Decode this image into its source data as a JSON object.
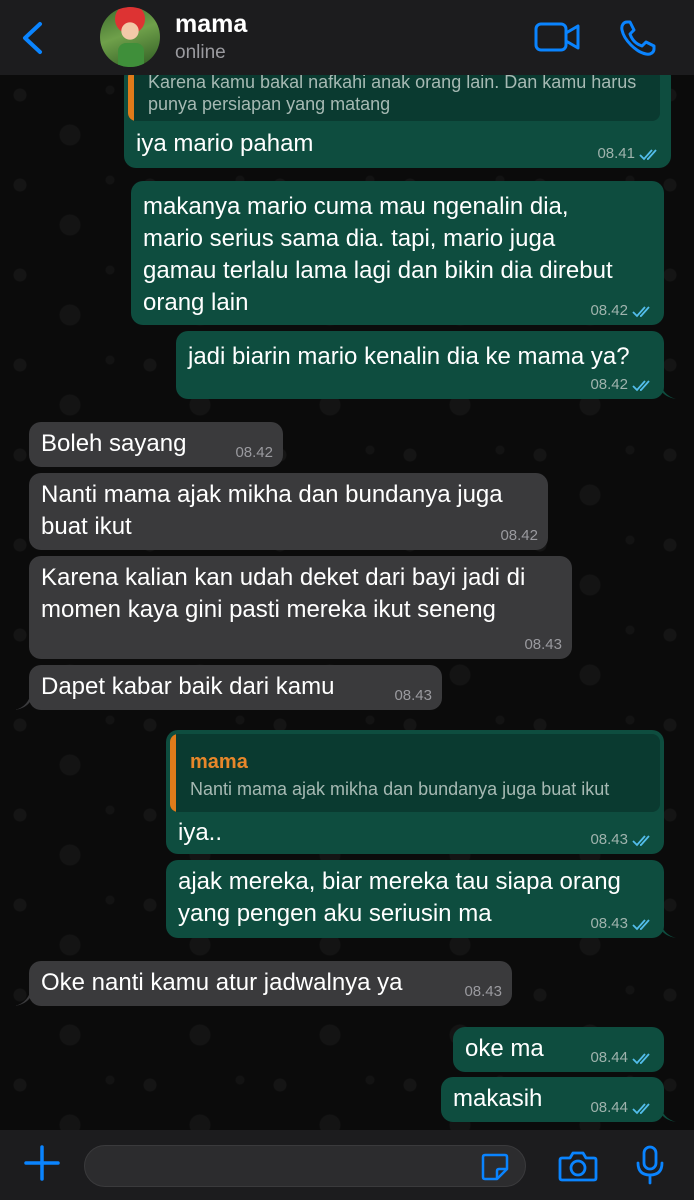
{
  "header": {
    "contact_name": "mama",
    "status": "online"
  },
  "messages": [
    {
      "id": "m1",
      "direction": "out",
      "quote_text": "Karena kamu bakal nafkahi anak orang lain. Dan kamu harus punya persiapan yang matang",
      "text": "iya mario paham",
      "time": "08.41"
    },
    {
      "id": "m2",
      "direction": "out",
      "text": "makanya mario cuma mau ngenalin dia,\nmario serius sama dia. tapi, mario juga\ngamau terlalu lama lagi dan bikin dia direbut\norang lain",
      "time": "08.42"
    },
    {
      "id": "m3",
      "direction": "out",
      "text": "jadi biarin mario kenalin dia ke mama ya?",
      "time": "08.42"
    },
    {
      "id": "m4",
      "direction": "in",
      "text": "Boleh sayang",
      "time": "08.42"
    },
    {
      "id": "m5",
      "direction": "in",
      "text": "Nanti mama ajak mikha dan bundanya juga\nbuat ikut",
      "time": "08.42"
    },
    {
      "id": "m6",
      "direction": "in",
      "text": "Karena kalian kan udah deket dari bayi jadi di\nmomen kaya gini pasti mereka ikut seneng",
      "time": "08.43"
    },
    {
      "id": "m7",
      "direction": "in",
      "text": "Dapet kabar baik dari kamu",
      "time": "08.43"
    },
    {
      "id": "m8",
      "direction": "out",
      "quote_author": "mama",
      "quote_text": "Nanti mama ajak mikha dan bundanya juga buat ikut",
      "text": "iya..",
      "time": "08.43"
    },
    {
      "id": "m9",
      "direction": "out",
      "text": "ajak mereka, biar mereka tau siapa orang\nyang pengen aku seriusin ma",
      "time": "08.43"
    },
    {
      "id": "m10",
      "direction": "in",
      "text": "Oke nanti kamu atur jadwalnya ya",
      "time": "08.43"
    },
    {
      "id": "m11",
      "direction": "out",
      "text": "oke ma",
      "time": "08.44"
    },
    {
      "id": "m12",
      "direction": "out",
      "text": "makasih",
      "time": "08.44"
    }
  ],
  "composer": {
    "value": ""
  },
  "colors": {
    "accent": "#0a84ff",
    "outgoing_bubble": "#0e4d3f",
    "incoming_bubble": "#3a3a3c",
    "quote_author": "#e8872a",
    "read_ticks": "#53bdeb"
  },
  "icons": {
    "back": "chevron-left-icon",
    "video": "video-camera-icon",
    "call": "phone-icon",
    "plus": "plus-icon",
    "sticker": "sticker-icon",
    "camera": "camera-icon",
    "mic": "microphone-icon",
    "read": "double-check-icon"
  }
}
